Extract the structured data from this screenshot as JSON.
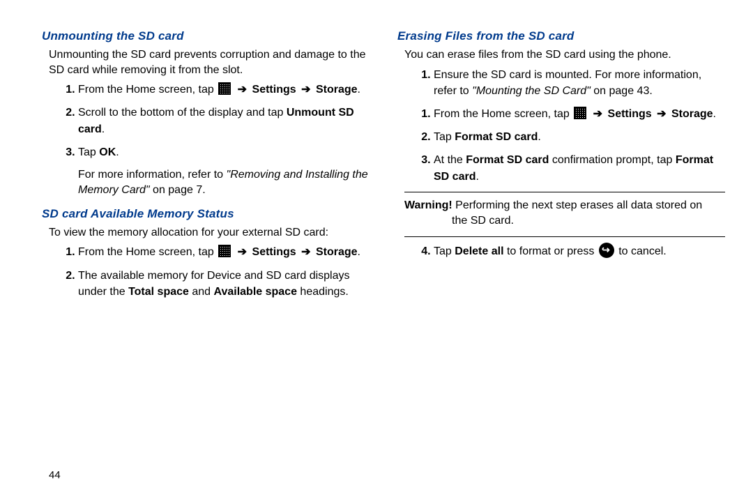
{
  "left": {
    "heading1": "Unmounting the SD card",
    "intro1": "Unmounting the SD card prevents corruption and damage to the SD card while removing it from the slot.",
    "step1_pre": "From the Home screen, tap",
    "step1_settings": "Settings",
    "step1_storage": "Storage",
    "step2_pre": "Scroll to the bottom of the display and tap ",
    "step2_bold": "Unmount SD card",
    "step3_pre": "Tap ",
    "step3_bold": "OK",
    "formore_pre": "For more information, refer to ",
    "formore_ref": "\"Removing and Installing the Memory Card\"",
    "formore_post": " on page 7.",
    "heading2": "SD card Available Memory Status",
    "intro2": "To view the memory allocation for your external SD card:",
    "m_step1_pre": "From the Home screen, tap",
    "m_step1_settings": "Settings",
    "m_step1_storage": "Storage",
    "m_step2_pre": "The available memory for Device and SD card displays under the ",
    "m_step2_b1": "Total space",
    "m_step2_mid": " and ",
    "m_step2_b2": "Available space",
    "m_step2_post": " headings."
  },
  "right": {
    "heading1": "Erasing Files from the SD card",
    "intro1": "You can erase files from the SD card using the phone.",
    "e_step1_pre": "Ensure the SD card is mounted. For more information, refer to ",
    "e_step1_ref": "\"Mounting the SD Card\"",
    "e_step1_post": " on page 43.",
    "e_step1b_pre": "From the Home screen, tap",
    "e_step1b_settings": "Settings",
    "e_step1b_storage": "Storage",
    "e_step2_pre": "Tap ",
    "e_step2_bold": "Format SD card",
    "e_step3_pre": "At the ",
    "e_step3_b1": "Format SD card",
    "e_step3_mid": " confirmation prompt, tap ",
    "e_step3_b2": "Format SD card",
    "warning_label": "Warning!",
    "warning_text1": " Performing the next step erases all data stored on",
    "warning_text2": "the SD card.",
    "e_step4_pre": "Tap ",
    "e_step4_bold": "Delete all",
    "e_step4_mid": " to format or press ",
    "e_step4_post": " to cancel."
  },
  "pagenum": "44"
}
